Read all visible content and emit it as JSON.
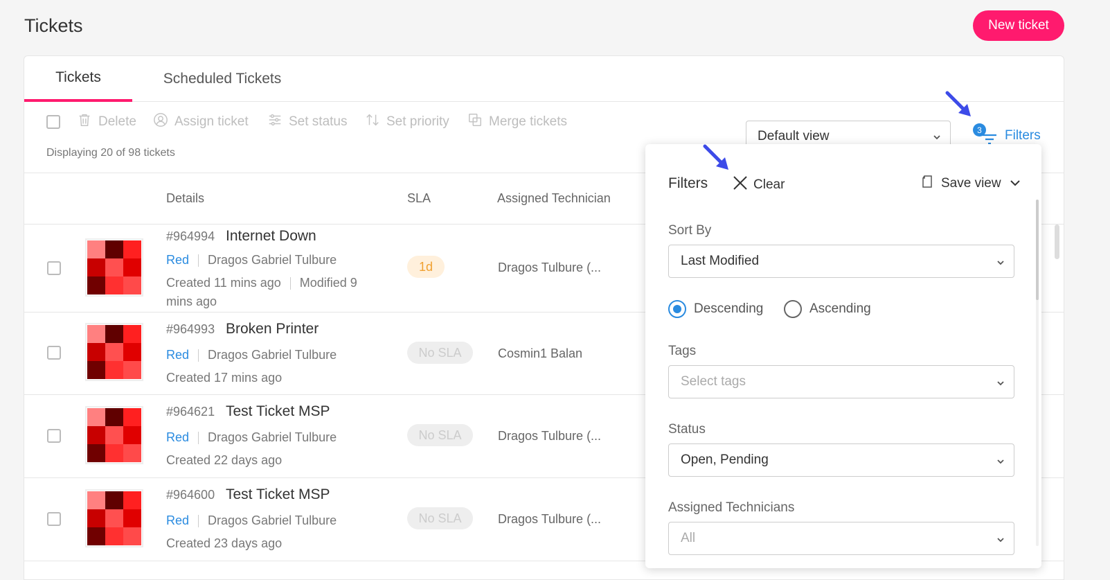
{
  "page": {
    "title": "Tickets",
    "new_ticket_label": "New ticket"
  },
  "tabs": [
    {
      "label": "Tickets",
      "active": true
    },
    {
      "label": "Scheduled Tickets",
      "active": false
    }
  ],
  "toolbar": {
    "delete": "Delete",
    "assign": "Assign ticket",
    "status": "Set status",
    "priority": "Set priority",
    "merge": "Merge tickets"
  },
  "displaying": "Displaying 20 of 98 tickets",
  "view_select": {
    "value": "Default view"
  },
  "filters": {
    "label": "Filters",
    "count": "3"
  },
  "table": {
    "headers": {
      "details": "Details",
      "sla": "SLA",
      "tech": "Assigned Technician"
    },
    "rows": [
      {
        "id": "#964994",
        "name": "Internet Down",
        "priority": "Red",
        "requester": "Dragos Gabriel Tulbure",
        "created": "Created 11 mins ago",
        "modified": "Modified 9",
        "modified2": "mins ago",
        "sla": "1d",
        "tech": "Dragos Tulbure (..."
      },
      {
        "id": "#964993",
        "name": "Broken Printer",
        "priority": "Red",
        "requester": "Dragos Gabriel Tulbure",
        "created": "Created 17 mins ago",
        "sla": "No SLA",
        "tech": "Cosmin1 Balan"
      },
      {
        "id": "#964621",
        "name": "Test Ticket MSP",
        "priority": "Red",
        "requester": "Dragos Gabriel Tulbure",
        "created": "Created 22 days ago",
        "sla": "No SLA",
        "tech": "Dragos Tulbure (..."
      },
      {
        "id": "#964600",
        "name": "Test Ticket MSP",
        "priority": "Red",
        "requester": "Dragos Gabriel Tulbure",
        "created": "Created 23 days ago",
        "sla": "No SLA",
        "tech": "Dragos Tulbure (..."
      }
    ]
  },
  "filter_panel": {
    "title": "Filters",
    "clear": "Clear",
    "save_view": "Save view",
    "sort_by_label": "Sort By",
    "sort_by_value": "Last Modified",
    "descending": "Descending",
    "ascending": "Ascending",
    "tags_label": "Tags",
    "tags_placeholder": "Select tags",
    "status_label": "Status",
    "status_value": "Open, Pending",
    "tech_label": "Assigned Technicians",
    "tech_value": "All"
  },
  "colors": {
    "accent": "#ff1a6e",
    "link": "#2a8be0",
    "annotation_arrow": "#3d4be8"
  }
}
